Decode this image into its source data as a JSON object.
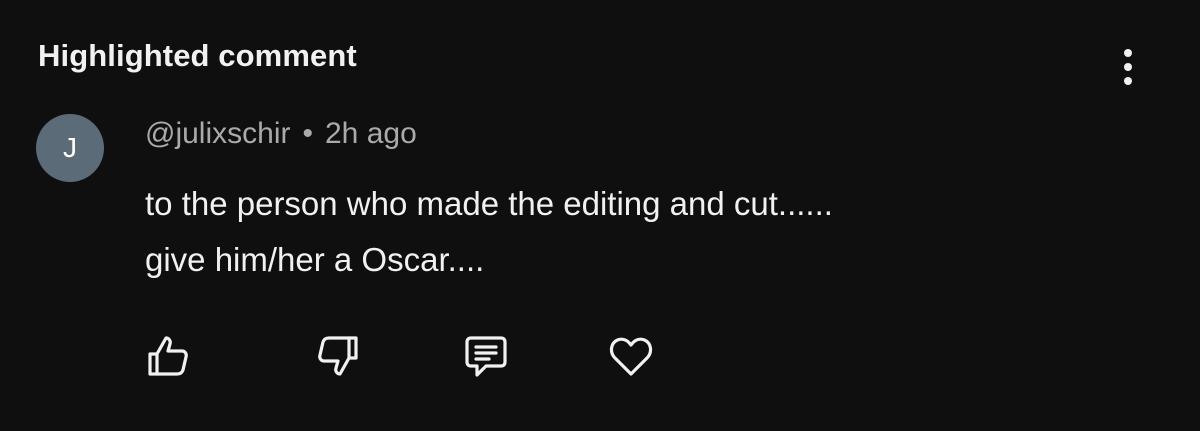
{
  "section": {
    "title": "Highlighted comment"
  },
  "comment": {
    "avatar_initial": "J",
    "avatar_color": "#5c6b78",
    "author": "@julixschir",
    "separator": "•",
    "time": "2h ago",
    "text_lines": [
      "to the person who made the editing and cut......",
      "give him/her a Oscar...."
    ]
  },
  "actions": {
    "icons": [
      "thumbs-up-icon",
      "thumbs-down-icon",
      "reply-icon",
      "heart-icon"
    ]
  },
  "menu": {
    "icon": "more-vertical-icon"
  },
  "colors": {
    "background": "#0f0f0f",
    "text_primary": "#f1f1f1",
    "text_secondary": "#aaaaaa"
  }
}
